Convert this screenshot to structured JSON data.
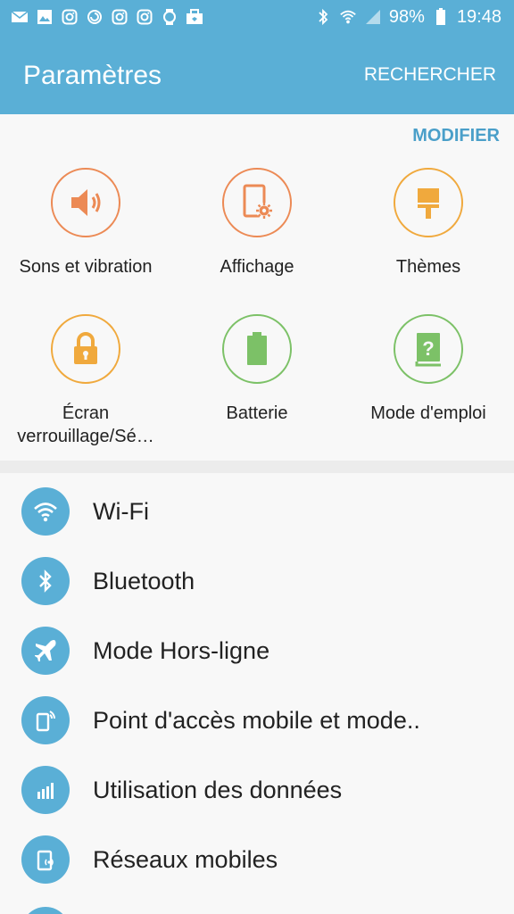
{
  "status_bar": {
    "battery": "98%",
    "time": "19:48",
    "left_icons": [
      "mail-icon",
      "gallery-icon",
      "instagram-icon",
      "sync-icon",
      "instagram-icon",
      "instagram-icon",
      "watch-icon",
      "briefcase-icon"
    ],
    "right_icons": [
      "bluetooth-icon",
      "wifi-calling-icon",
      "signal-icon",
      "battery-icon"
    ]
  },
  "header": {
    "title": "Paramètres",
    "search_label": "RECHERCHER"
  },
  "quick_settings": {
    "modify_label": "MODIFIER",
    "items": [
      {
        "label": "Sons et vibration",
        "icon": "speaker-icon",
        "color": "#ec8a55"
      },
      {
        "label": "Affichage",
        "icon": "display-settings-icon",
        "color": "#ec8a55"
      },
      {
        "label": "Thèmes",
        "icon": "brush-icon",
        "color": "#f0a93d"
      },
      {
        "label": "Écran verrouillage/Sé…",
        "icon": "lock-icon",
        "color": "#f0a93d"
      },
      {
        "label": "Batterie",
        "icon": "battery-icon",
        "color": "#7cc167"
      },
      {
        "label": "Mode d'emploi",
        "icon": "help-book-icon",
        "color": "#7cc167"
      }
    ]
  },
  "settings_list": [
    {
      "label": "Wi-Fi",
      "icon": "wifi-icon"
    },
    {
      "label": "Bluetooth",
      "icon": "bluetooth-icon"
    },
    {
      "label": "Mode Hors-ligne",
      "icon": "airplane-icon"
    },
    {
      "label": "Point d'accès mobile et mode..",
      "icon": "hotspot-icon"
    },
    {
      "label": "Utilisation des données",
      "icon": "data-usage-icon"
    },
    {
      "label": "Réseaux mobiles",
      "icon": "mobile-network-icon"
    }
  ],
  "colors": {
    "primary": "#5aafd6",
    "accent_text": "#4a9fc9",
    "orange": "#ec8a55",
    "amber": "#f0a93d",
    "green": "#7cc167"
  }
}
